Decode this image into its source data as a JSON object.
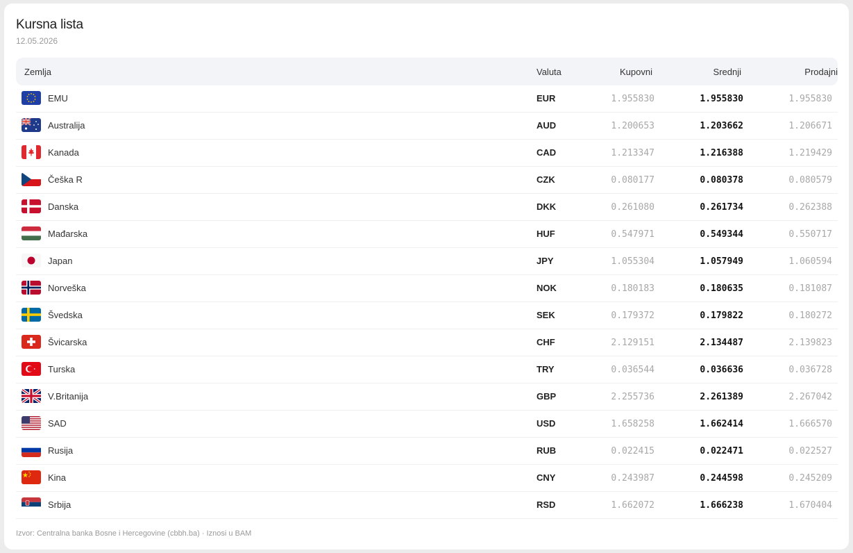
{
  "title": "Kursna lista",
  "date": "12.05.2026",
  "columns": {
    "country": "Zemlja",
    "currency": "Valuta",
    "buy": "Kupovni",
    "mid": "Srednji",
    "sell": "Prodajni"
  },
  "rows": [
    {
      "flag": "eu-flag-icon",
      "country": "EMU",
      "code": "EUR",
      "buy": "1.955830",
      "mid": "1.955830",
      "sell": "1.955830"
    },
    {
      "flag": "australia-flag-icon",
      "country": "Australija",
      "code": "AUD",
      "buy": "1.200653",
      "mid": "1.203662",
      "sell": "1.206671"
    },
    {
      "flag": "canada-flag-icon",
      "country": "Kanada",
      "code": "CAD",
      "buy": "1.213347",
      "mid": "1.216388",
      "sell": "1.219429"
    },
    {
      "flag": "czech-flag-icon",
      "country": "Češka R",
      "code": "CZK",
      "buy": "0.080177",
      "mid": "0.080378",
      "sell": "0.080579"
    },
    {
      "flag": "denmark-flag-icon",
      "country": "Danska",
      "code": "DKK",
      "buy": "0.261080",
      "mid": "0.261734",
      "sell": "0.262388"
    },
    {
      "flag": "hungary-flag-icon",
      "country": "Mađarska",
      "code": "HUF",
      "buy": "0.547971",
      "mid": "0.549344",
      "sell": "0.550717"
    },
    {
      "flag": "japan-flag-icon",
      "country": "Japan",
      "code": "JPY",
      "buy": "1.055304",
      "mid": "1.057949",
      "sell": "1.060594"
    },
    {
      "flag": "norway-flag-icon",
      "country": "Norveška",
      "code": "NOK",
      "buy": "0.180183",
      "mid": "0.180635",
      "sell": "0.181087"
    },
    {
      "flag": "sweden-flag-icon",
      "country": "Švedska",
      "code": "SEK",
      "buy": "0.179372",
      "mid": "0.179822",
      "sell": "0.180272"
    },
    {
      "flag": "switzerland-flag-icon",
      "country": "Švicarska",
      "code": "CHF",
      "buy": "2.129151",
      "mid": "2.134487",
      "sell": "2.139823"
    },
    {
      "flag": "turkey-flag-icon",
      "country": "Turska",
      "code": "TRY",
      "buy": "0.036544",
      "mid": "0.036636",
      "sell": "0.036728"
    },
    {
      "flag": "uk-flag-icon",
      "country": "V.Britanija",
      "code": "GBP",
      "buy": "2.255736",
      "mid": "2.261389",
      "sell": "2.267042"
    },
    {
      "flag": "usa-flag-icon",
      "country": "SAD",
      "code": "USD",
      "buy": "1.658258",
      "mid": "1.662414",
      "sell": "1.666570"
    },
    {
      "flag": "russia-flag-icon",
      "country": "Rusija",
      "code": "RUB",
      "buy": "0.022415",
      "mid": "0.022471",
      "sell": "0.022527"
    },
    {
      "flag": "china-flag-icon",
      "country": "Kina",
      "code": "CNY",
      "buy": "0.243987",
      "mid": "0.244598",
      "sell": "0.245209"
    },
    {
      "flag": "serbia-flag-icon",
      "country": "Srbija",
      "code": "RSD",
      "buy": "1.662072",
      "mid": "1.666238",
      "sell": "1.670404"
    }
  ],
  "footer": "Izvor: Centralna banka Bosne i Hercegovine (cbbh.ba) · Iznosi u BAM"
}
